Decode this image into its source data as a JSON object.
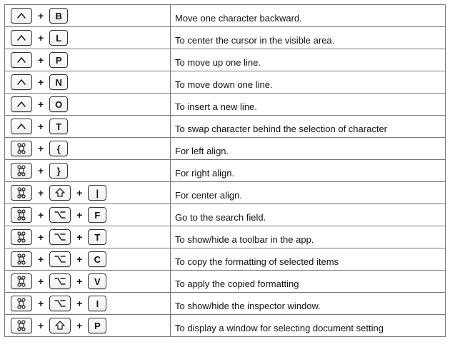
{
  "glyphs": {
    "ctrl": "^",
    "cmd": "⌘",
    "shift": "⇧",
    "opt": "⌥"
  },
  "plus": "+",
  "rows": [
    {
      "keys": [
        "ctrl",
        "B"
      ],
      "desc": "Move one character backward."
    },
    {
      "keys": [
        "ctrl",
        "L"
      ],
      "desc": "To center the cursor in the visible area."
    },
    {
      "keys": [
        "ctrl",
        "P"
      ],
      "desc": "To move up one line."
    },
    {
      "keys": [
        "ctrl",
        "N"
      ],
      "desc": "To move down one line."
    },
    {
      "keys": [
        "ctrl",
        "O"
      ],
      "desc": "To insert a new line."
    },
    {
      "keys": [
        "ctrl",
        "T"
      ],
      "desc": "To swap character behind the selection of character"
    },
    {
      "keys": [
        "cmd",
        "{"
      ],
      "desc": "For left align."
    },
    {
      "keys": [
        "cmd",
        "}"
      ],
      "desc": "For right align."
    },
    {
      "keys": [
        "cmd",
        "shift",
        "|"
      ],
      "desc": "For center align."
    },
    {
      "keys": [
        "cmd",
        "opt",
        "F"
      ],
      "desc": "Go to the search field."
    },
    {
      "keys": [
        "cmd",
        "opt",
        "T"
      ],
      "desc": "To show/hide a toolbar in the app."
    },
    {
      "keys": [
        "cmd",
        "opt",
        "C"
      ],
      "desc": "To copy the formatting of selected items"
    },
    {
      "keys": [
        "cmd",
        "opt",
        "V"
      ],
      "desc": "To apply the copied formatting"
    },
    {
      "keys": [
        "cmd",
        "opt",
        "I"
      ],
      "desc": "To show/hide the inspector window."
    },
    {
      "keys": [
        "cmd",
        "shift",
        "P"
      ],
      "desc": "To display a window for selecting document setting"
    }
  ]
}
